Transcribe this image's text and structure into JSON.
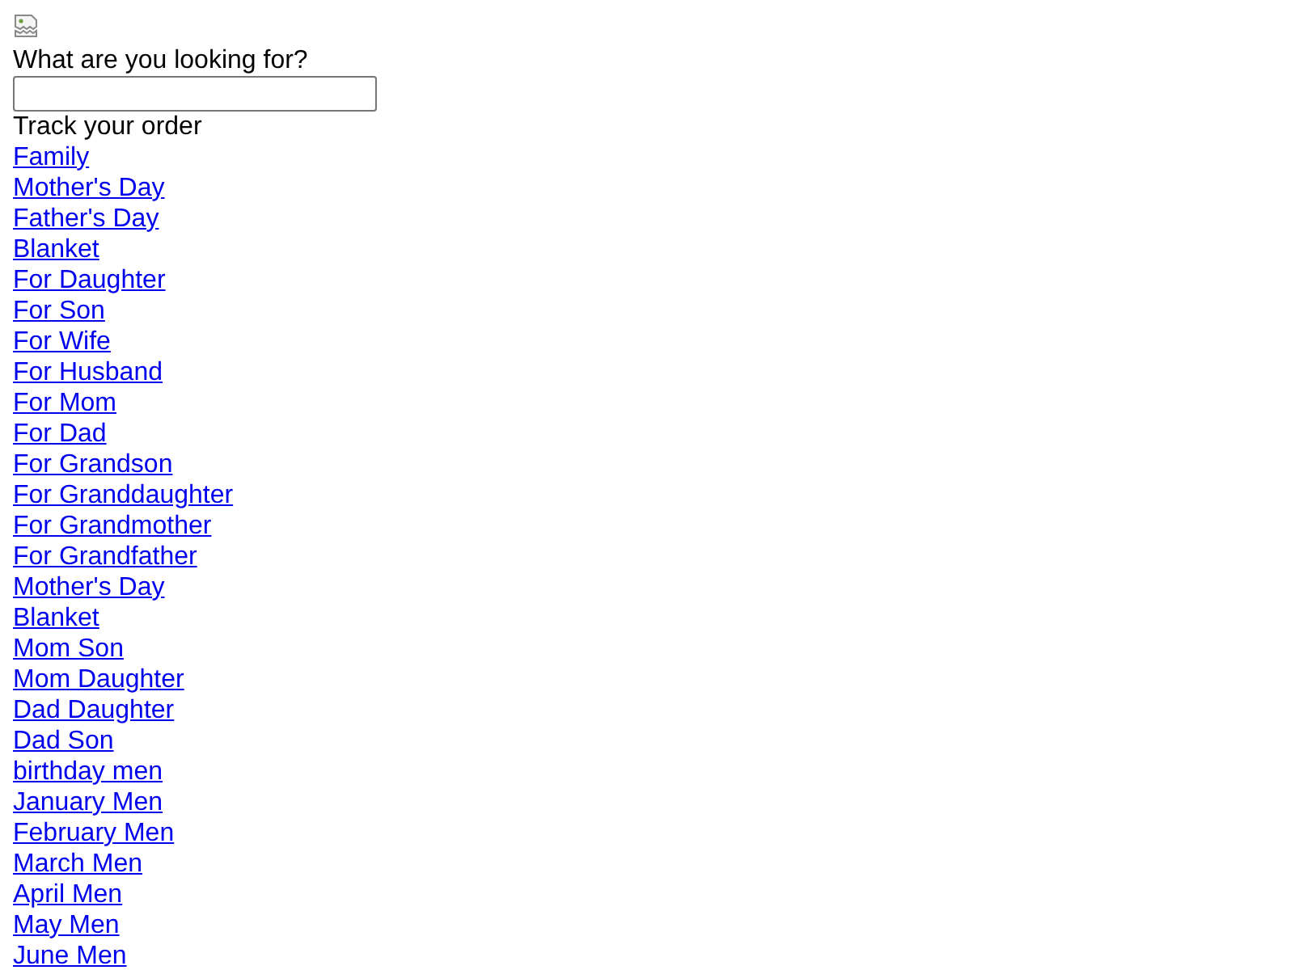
{
  "search": {
    "label": "What are you looking for?"
  },
  "track_order": "Track your order",
  "links": [
    "Family",
    "Mother's Day",
    "Father's Day",
    "Blanket",
    "For Daughter",
    "For Son",
    "For Wife",
    "For Husband",
    "For Mom",
    "For Dad",
    "For Grandson",
    "For Granddaughter",
    "For Grandmother",
    "For Grandfather",
    "Mother's Day",
    "Blanket",
    "Mom Son",
    "Mom Daughter",
    "Dad Daughter",
    "Dad Son",
    "birthday men",
    "January Men",
    "February Men",
    "March Men",
    "April Men",
    "May Men",
    "June Men"
  ]
}
